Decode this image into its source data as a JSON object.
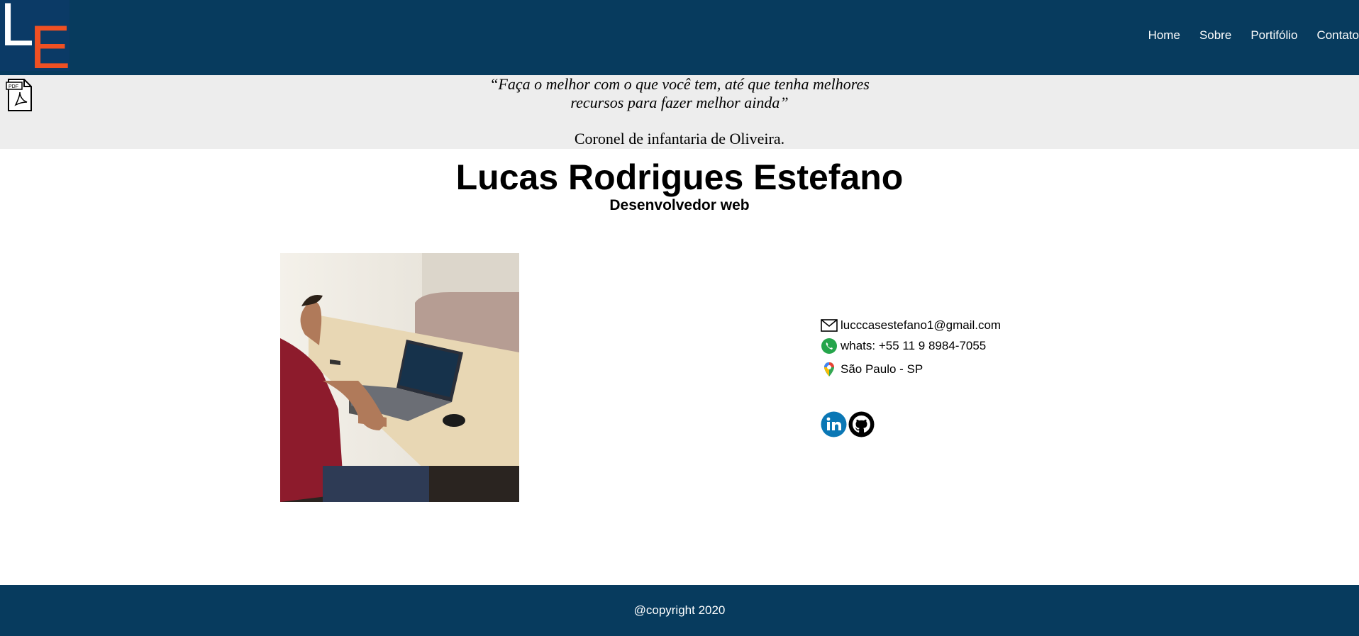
{
  "header": {
    "logo": {
      "letters": [
        "L",
        "E"
      ],
      "colors": {
        "background": "#0b3a66",
        "l": "#ffffff",
        "e": "#f05023"
      }
    },
    "nav": [
      {
        "label": "Home"
      },
      {
        "label": "Sobre"
      },
      {
        "label": "Portifólio"
      },
      {
        "label": "Contato"
      }
    ],
    "background": "#073b5e"
  },
  "quote_band": {
    "pdf_icon": "pdf-file-icon",
    "quote_line1": "“Faça o melhor com o que você tem, até que tenha melhores",
    "quote_line2": "recursos para fazer melhor ainda”",
    "author": "Coronel de infantaria de Oliveira.",
    "background": "#ededed"
  },
  "profile": {
    "name": "Lucas Rodrigues Estefano",
    "role": "Desenvolvedor web",
    "photo": "person-at-laptop-photo"
  },
  "contact": {
    "email": {
      "icon": "envelope-icon",
      "text": "lucccasestefano1@gmail.com"
    },
    "phone": {
      "icon": "whatsapp-icon",
      "text": "whats: +55 11 9 8984-7055"
    },
    "location": {
      "icon": "map-pin-icon",
      "text": "São Paulo - SP"
    }
  },
  "social": [
    {
      "icon": "linkedin-icon",
      "color": "#0a77b5"
    },
    {
      "icon": "github-icon",
      "color": "#000000"
    }
  ],
  "footer": {
    "text": "@copyright 2020",
    "background": "#073b5e"
  }
}
